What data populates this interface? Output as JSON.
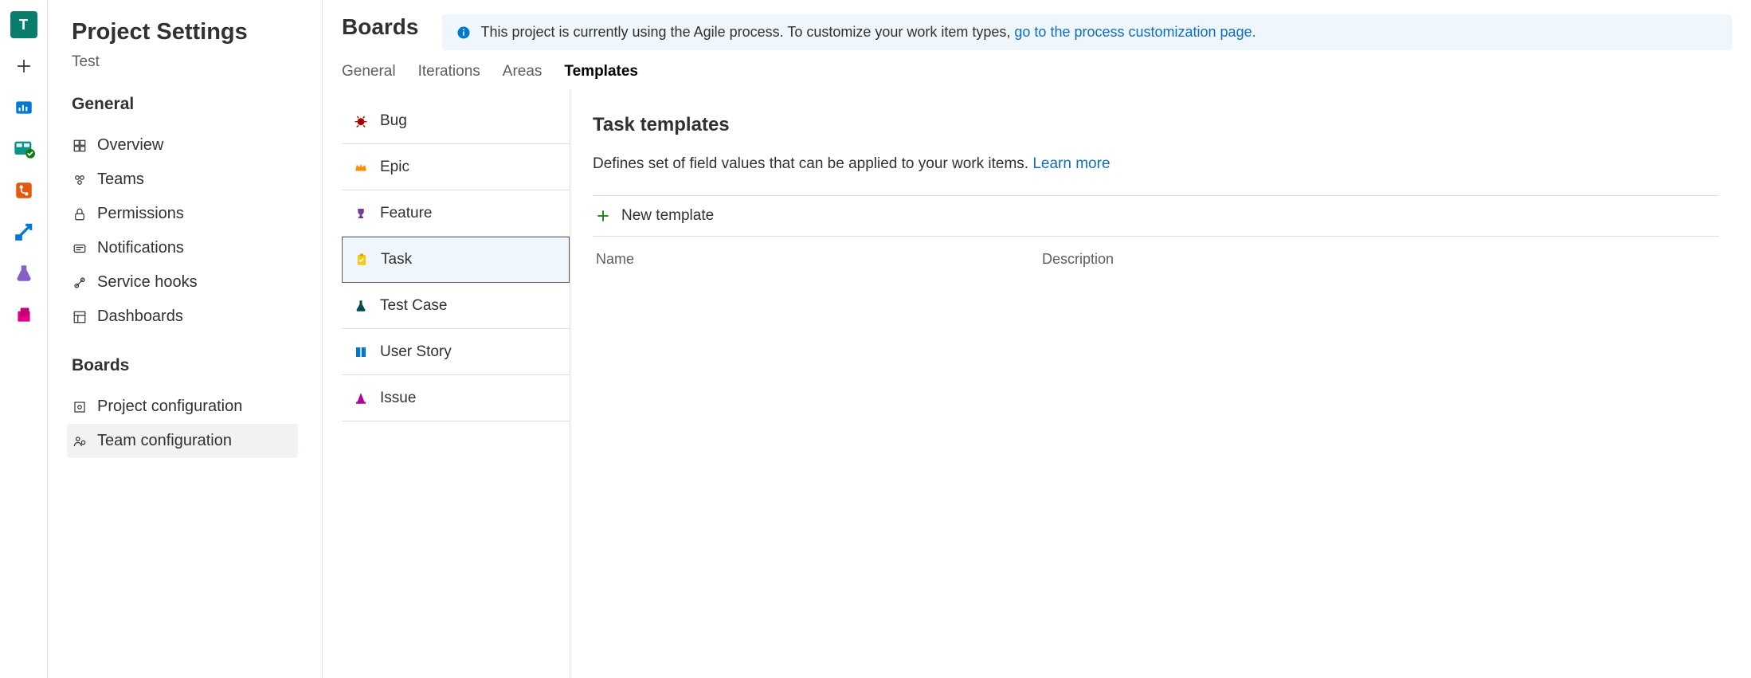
{
  "rail": {
    "project_initial": "T"
  },
  "sidebar": {
    "title": "Project Settings",
    "project_name": "Test",
    "group_general": "General",
    "links_general": [
      {
        "icon": "overview",
        "label": "Overview"
      },
      {
        "icon": "teams",
        "label": "Teams"
      },
      {
        "icon": "lock",
        "label": "Permissions"
      },
      {
        "icon": "notifications",
        "label": "Notifications"
      },
      {
        "icon": "hooks",
        "label": "Service hooks"
      },
      {
        "icon": "dashboards",
        "label": "Dashboards"
      }
    ],
    "group_boards": "Boards",
    "links_boards": [
      {
        "icon": "config",
        "label": "Project configuration",
        "active": false
      },
      {
        "icon": "team-config",
        "label": "Team configuration",
        "active": true
      }
    ]
  },
  "main": {
    "title": "Boards",
    "banner_text_a": "This project is currently using the Agile process. To customize your work item types, ",
    "banner_link": "go to the process customization page.",
    "tabs": [
      {
        "label": "General",
        "active": false
      },
      {
        "label": "Iterations",
        "active": false
      },
      {
        "label": "Areas",
        "active": false
      },
      {
        "label": "Templates",
        "active": true
      }
    ],
    "wits": [
      {
        "label": "Bug",
        "color": "#a80000",
        "icon": "bug",
        "selected": false
      },
      {
        "label": "Epic",
        "color": "#ff8c00",
        "icon": "crown",
        "selected": false
      },
      {
        "label": "Feature",
        "color": "#773b93",
        "icon": "trophy",
        "selected": false
      },
      {
        "label": "Task",
        "color": "#f2cb1d",
        "icon": "clipboard",
        "selected": true
      },
      {
        "label": "Test Case",
        "color": "#004b50",
        "icon": "flask",
        "selected": false
      },
      {
        "label": "User Story",
        "color": "#0078d4",
        "icon": "book",
        "selected": false
      },
      {
        "label": "Issue",
        "color": "#b4009e",
        "icon": "cone",
        "selected": false
      }
    ],
    "templates": {
      "title": "Task templates",
      "description": "Defines set of field values that can be applied to your work items. ",
      "learn_more": "Learn more",
      "new_label": "New template",
      "col_name": "Name",
      "col_desc": "Description"
    }
  }
}
